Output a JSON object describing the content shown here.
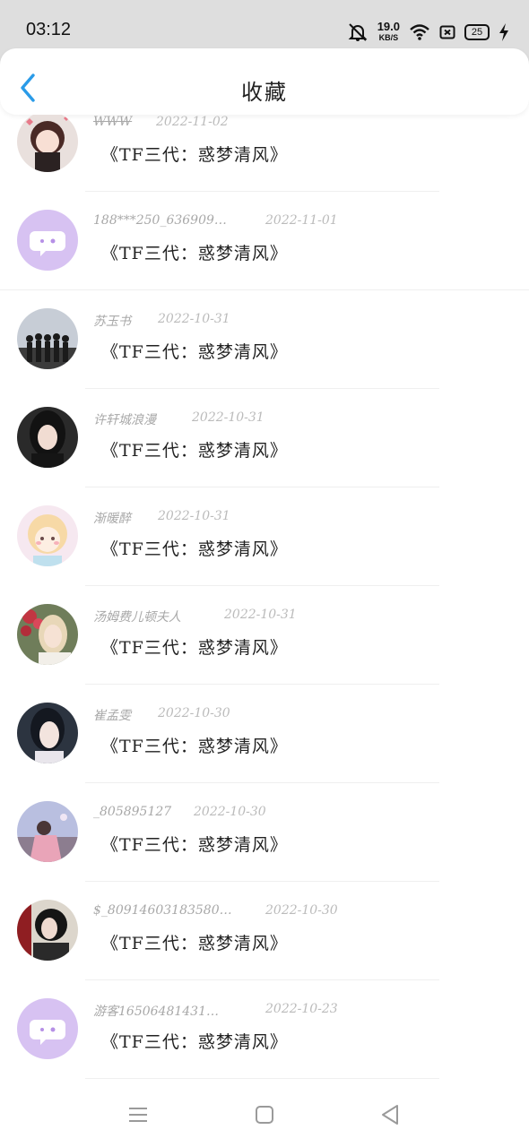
{
  "status_bar": {
    "time": "03:12",
    "speed_value": "19.0",
    "speed_unit": "KB/S",
    "battery": "25",
    "icons": [
      "mute-bell-icon",
      "wifi-icon",
      "sim-icon",
      "battery-icon",
      "charging-icon"
    ]
  },
  "header": {
    "title": "收藏",
    "back_icon": "chevron-left-icon",
    "accent_color": "#2a9be8"
  },
  "items": [
    {
      "user": "WWW",
      "date": "2022-11-02",
      "title": "《TF三代：惑梦清风》",
      "avatar": "anime-girl"
    },
    {
      "user": "188***250_636909…",
      "date": "2022-11-01",
      "title": "《TF三代：惑梦清风》",
      "avatar": "default-chat"
    },
    {
      "user": "苏玉书",
      "date": "2022-10-31",
      "title": "《TF三代：惑梦清风》",
      "avatar": "group-silhouette"
    },
    {
      "user": "许轩城浪漫",
      "date": "2022-10-31",
      "title": "《TF三代：惑梦清风》",
      "avatar": "girl-dark"
    },
    {
      "user": "渐暖醉",
      "date": "2022-10-31",
      "title": "《TF三代：惑梦清风》",
      "avatar": "anime-pastel"
    },
    {
      "user": "汤姆费儿顿夫人",
      "date": "2022-10-31",
      "title": "《TF三代：惑梦清风》",
      "avatar": "girl-flowers"
    },
    {
      "user": "崔孟雯",
      "date": "2022-10-30",
      "title": "《TF三代：惑梦清风》",
      "avatar": "girl-portrait"
    },
    {
      "user": "_805895127",
      "date": "2022-10-30",
      "title": "《TF三代：惑梦清风》",
      "avatar": "girl-pink"
    },
    {
      "user": "$_80914603183580…",
      "date": "2022-10-30",
      "title": "《TF三代：惑梦清风》",
      "avatar": "girl-hat"
    },
    {
      "user": "游客16506481431…",
      "date": "2022-10-23",
      "title": "《TF三代：惑梦清风》",
      "avatar": "default-chat"
    }
  ],
  "nav_bar": {
    "icons": [
      "menu-icon",
      "home-square-icon",
      "back-triangle-icon"
    ]
  }
}
